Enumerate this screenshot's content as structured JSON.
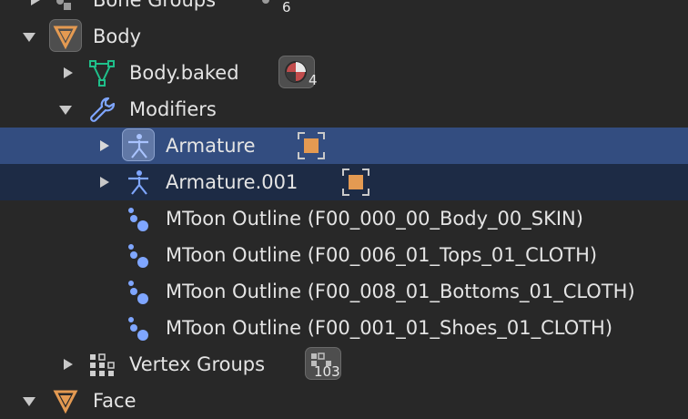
{
  "outliner": {
    "bone_groups": {
      "label": "Bone Groups",
      "count": "6"
    },
    "body": {
      "label": "Body"
    },
    "body_baked": {
      "label": "Body.baked",
      "badge_count": "4"
    },
    "modifiers": {
      "label": "Modifiers"
    },
    "armature": {
      "label": "Armature"
    },
    "armature_001": {
      "label": "Armature.001"
    },
    "outlines": [
      {
        "label": "MToon Outline (F00_000_00_Body_00_SKIN)"
      },
      {
        "label": "MToon Outline (F00_006_01_Tops_01_CLOTH)"
      },
      {
        "label": "MToon Outline (F00_008_01_Bottoms_01_CLOTH)"
      },
      {
        "label": "MToon Outline (F00_001_01_Shoes_01_CLOTH)"
      }
    ],
    "vertex_groups": {
      "label": "Vertex Groups",
      "count": "103"
    },
    "face": {
      "label": "Face"
    }
  },
  "colors": {
    "background": "#282828",
    "selected_row": "#334d80",
    "active_row": "#1d2b45",
    "mesh_green": "#1fbf8a",
    "modifier_blue": "#7fa6ff",
    "object_orange": "#e49a52"
  }
}
